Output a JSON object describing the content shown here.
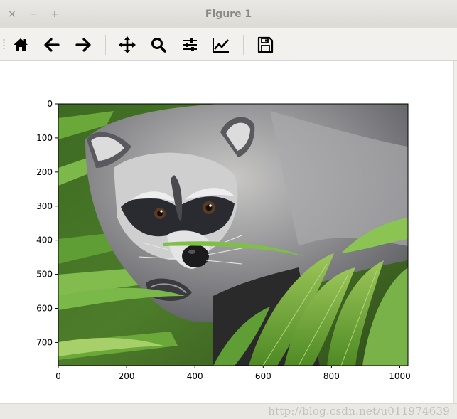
{
  "window": {
    "title": "Figure 1",
    "close_glyph": "×",
    "minimize_glyph": "−",
    "maximize_glyph": "+"
  },
  "toolbar": {
    "items": [
      {
        "name": "home",
        "icon": "home-icon",
        "tooltip": "Reset original view"
      },
      {
        "name": "back",
        "icon": "arrow-left-icon",
        "tooltip": "Back to previous view"
      },
      {
        "name": "forward",
        "icon": "arrow-right-icon",
        "tooltip": "Forward to next view"
      },
      {
        "name": "pan",
        "icon": "move-icon",
        "tooltip": "Pan axes"
      },
      {
        "name": "zoom",
        "icon": "magnifier-icon",
        "tooltip": "Zoom to rectangle"
      },
      {
        "name": "subplots",
        "icon": "sliders-icon",
        "tooltip": "Configure subplots"
      },
      {
        "name": "customize",
        "icon": "line-chart-icon",
        "tooltip": "Edit axis, curve and image parameters"
      },
      {
        "name": "save",
        "icon": "floppy-disk-icon",
        "tooltip": "Save the figure"
      }
    ]
  },
  "plot": {
    "type": "image",
    "subject": "raccoon among green palm leaves",
    "x_ticks": [
      "0",
      "200",
      "400",
      "600",
      "800",
      "1000"
    ],
    "x_tick_values": [
      0,
      200,
      400,
      600,
      800,
      1000
    ],
    "y_ticks": [
      "0",
      "100",
      "200",
      "300",
      "400",
      "500",
      "600",
      "700"
    ],
    "y_tick_values": [
      0,
      100,
      200,
      300,
      400,
      500,
      600,
      700
    ],
    "xlim": [
      0,
      1024
    ],
    "ylim": [
      0,
      768
    ],
    "y_inverted": true
  },
  "watermark": "http://blog.csdn.net/u011974639",
  "colors": {
    "leaf_green": "#5a9a2e",
    "fur_gray": "#8e8f93",
    "mask_dark": "#2a2b30"
  }
}
